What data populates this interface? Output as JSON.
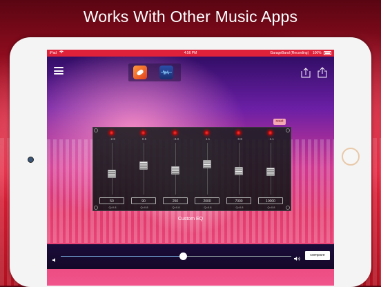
{
  "headline": "Works With Other Music Apps",
  "status_bar": {
    "device": "iPad",
    "time": "4:56 PM",
    "right": "GarageBand (Recording)",
    "battery": "100%"
  },
  "toolbar": {
    "menu_icon": "hamburger-icon",
    "apps": [
      "garageband-app-icon",
      "equalizer-app-icon"
    ],
    "import_icon": "upload-icon",
    "share_icon": "share-icon"
  },
  "eq": {
    "reset_label": "reset",
    "title": "Custom EQ",
    "bands": [
      {
        "gain": "-2.8",
        "freq": "50",
        "q": "Q=0.8",
        "level": 0.38
      },
      {
        "gain": "0.5",
        "freq": "90",
        "q": "Q=0.8",
        "level": 0.57
      },
      {
        "gain": "-3.3",
        "freq": "250",
        "q": "Q=0.8",
        "level": 0.46
      },
      {
        "gain": "1.1",
        "freq": "2000",
        "q": "Q=0.8",
        "level": 0.6
      },
      {
        "gain": "-0.8",
        "freq": "7000",
        "q": "Q=0.8",
        "level": 0.45
      },
      {
        "gain": "-1.1",
        "freq": "10000",
        "q": "Q=0.8",
        "level": 0.43
      }
    ]
  },
  "player": {
    "volume_level": 0.53,
    "compare_label": "compare"
  },
  "colors": {
    "accent": "#e0213a",
    "led": "#ff3a3a",
    "slider_fill": "#7ad"
  }
}
